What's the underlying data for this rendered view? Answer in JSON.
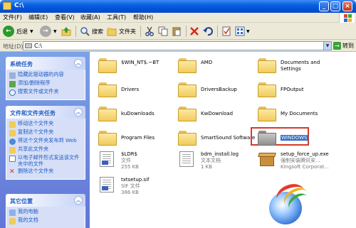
{
  "window": {
    "title": "C:\\"
  },
  "menu": [
    "文件(F)",
    "编辑(E)",
    "查看(V)",
    "收藏(A)",
    "工具(T)",
    "帮助(H)"
  ],
  "toolbar": {
    "back": "后退",
    "search": "搜索",
    "folders": "文件夹"
  },
  "address": {
    "label": "地址(D)",
    "value": "C:\\",
    "go": "转到"
  },
  "system_tasks": {
    "title": "系统任务",
    "items": [
      "隐藏此驱动器的内容",
      "添加/删除程序",
      "搜索文件或文件夹"
    ]
  },
  "file_tasks": {
    "title": "文件和文件夹任务",
    "items": [
      "移动这个文件夹",
      "复制这个文件夹",
      "将这个文件夹发布到 Web",
      "共享此文件夹",
      "以电子邮件形式发送该文件夹中的文件",
      "删除这个文件夹"
    ]
  },
  "other_places": {
    "title": "其它位置",
    "items": [
      "我的电脑",
      "我的文档"
    ]
  },
  "files": [
    {
      "name": "$WIN_NT$.~BT"
    },
    {
      "name": "AMD"
    },
    {
      "name": "Documents and Settings"
    },
    {
      "name": "Drivers"
    },
    {
      "name": "DriversBackup"
    },
    {
      "name": "FPOutput"
    },
    {
      "name": "kuDownloads"
    },
    {
      "name": "KwDownload"
    },
    {
      "name": "My Documents"
    },
    {
      "name": "Program Files"
    },
    {
      "name": "SmartSound Software"
    },
    {
      "name": "WINDOWS"
    },
    {
      "name": "$LDR$",
      "type": "文件",
      "size": "255 KB"
    },
    {
      "name": "bdm_install.log",
      "type": "文本文档",
      "size": "1 KB"
    },
    {
      "name": "setup_force_up.exe",
      "type": "强制安装腾讯安...",
      "company": "Kingsoft Corporat..."
    },
    {
      "name": "txtsetup.sif",
      "type": "SIF 文件",
      "size": "386 KB"
    }
  ],
  "colors": {
    "title_blue": "#0a5fe0",
    "task_pane": "#7ba2e7",
    "selection": "#316ac5",
    "highlight_frame": "#d43a2a"
  }
}
